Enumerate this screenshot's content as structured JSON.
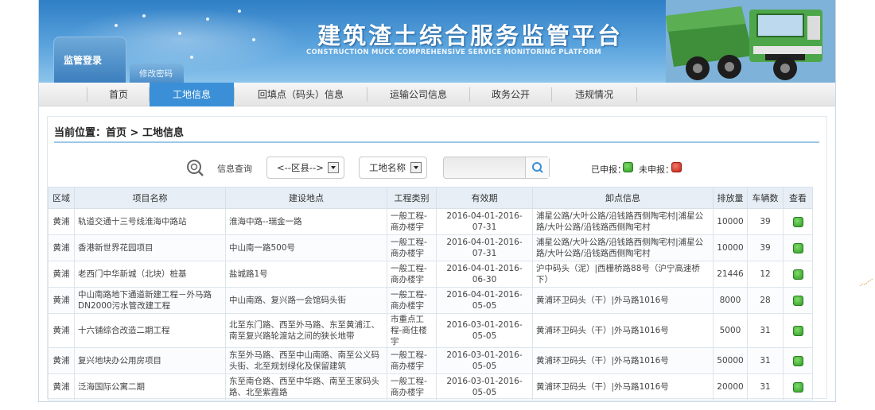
{
  "header": {
    "title_cn": "建筑渣土综合服务监管平台",
    "title_en": "CONSTRUCTION MUCK COMPREHENSIVE SERVICE MONITORING PLATFORM",
    "login_label": "监管登录",
    "change_pwd_label": "修改密码"
  },
  "nav": {
    "items": [
      {
        "label": "首页"
      },
      {
        "label": "工地信息"
      },
      {
        "label": "回填点（码头）信息"
      },
      {
        "label": "运输公司信息"
      },
      {
        "label": "政务公开"
      },
      {
        "label": "违规情况"
      }
    ],
    "active_index": 1
  },
  "breadcrumb": "当前位置：首页 > 工地信息",
  "search": {
    "label": "信息查询",
    "district_select": "<--区县-->",
    "site_name_select": "工地名称",
    "input_value": "",
    "reported_label": "已申报：",
    "not_reported_label": "未申报："
  },
  "colors": {
    "accent": "#3a8fd6",
    "reported": "#2f9a25",
    "not_reported": "#c42015"
  },
  "table": {
    "headers": [
      "区域",
      "项目名称",
      "建设地点",
      "工程类别",
      "有效期",
      "卸点信息",
      "排放量",
      "车辆数",
      "查看"
    ],
    "rows": [
      [
        "黄浦",
        "轨道交通十三号线淮海中路站",
        "淮海中路--瑞金一路",
        "一般工程-商办楼宇",
        "2016-04-01-2016-07-31",
        "浦星公路/大叶公路/沿钱路西侧陶宅村|浦星公路/大叶公路/沿钱路西侧陶宅村",
        "10000",
        "39"
      ],
      [
        "黄浦",
        "香港新世界花园项目",
        "中山南一路500号",
        "一般工程-商办楼宇",
        "2016-04-01-2016-07-31",
        "浦星公路/大叶公路/沿钱路西侧陶宅村|浦星公路/大叶公路/沿钱路西侧陶宅村",
        "10000",
        "39"
      ],
      [
        "黄浦",
        "老西门中华新城（北块）桩基",
        "盐城路1号",
        "一般工程-商办楼宇",
        "2016-04-01-2016-06-30",
        "沪中码头（泥）|西栅桥路88号（沪宁高速桥下）",
        "21446",
        "12"
      ],
      [
        "黄浦",
        "中山南路地下通道新建工程－外马路DN2000污水管改建工程",
        "中山南路、复兴路一会馆码头街",
        "一般工程-商办楼宇",
        "2016-04-01-2016-05-05",
        "黄浦环卫码头（干）|外马路1016号",
        "8000",
        "28"
      ],
      [
        "黄浦",
        "十六铺综合改造二期工程",
        "北至东门路、西至外马路、东至黄浦江、南至复兴路轮渡站之间的狭长地带",
        "市重点工程-商住楼宇",
        "2016-03-01-2016-05-05",
        "黄浦环卫码头（干）|外马路1016号",
        "5000",
        "31"
      ],
      [
        "黄浦",
        "复兴地块办公用房项目",
        "东至外马路、西至中山南路、南至公义码头街、北至规划绿化及保留建筑",
        "一般工程-商办楼宇",
        "2016-03-01-2016-05-05",
        "黄浦环卫码头（干）|外马路1016号",
        "50000",
        "31"
      ],
      [
        "黄浦",
        "泛海国际公寓二期",
        "东至南仓路、西至中华路、南至王家码头路、北至紫霞路",
        "一般工程-商办楼宇",
        "2016-03-01-2016-05-05",
        "黄浦环卫码头（干）|外马路1016号",
        "20000",
        "31"
      ]
    ]
  }
}
